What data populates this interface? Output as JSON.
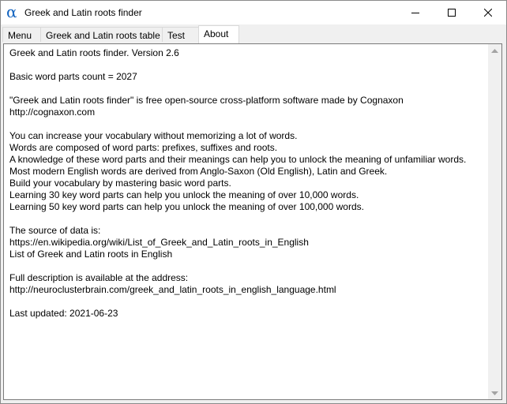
{
  "window": {
    "title": "Greek and Latin roots finder",
    "app_icon_glyph": "α",
    "accent_color": "#1565c0"
  },
  "tabs": [
    {
      "label": "Menu",
      "active": false
    },
    {
      "label": "Greek and Latin roots table",
      "active": false
    },
    {
      "label": "Test",
      "active": false
    },
    {
      "label": "About",
      "active": true
    }
  ],
  "about": {
    "version_line": "Greek and Latin roots finder. Version 2.6",
    "count_line": "Basic word parts count = 2027",
    "license_line": "\"Greek and Latin roots finder\" is free open-source cross-platform software made by Cognaxon",
    "site_url": "http://cognaxon.com",
    "intro_lines": [
      "You can increase your vocabulary without memorizing a lot of words.",
      "Words are composed of word parts: prefixes, suffixes and roots.",
      "A knowledge of these word parts and their meanings can help you to unlock the meaning of unfamiliar words.",
      "Most modern English words are derived from Anglo-Saxon (Old English), Latin and Greek.",
      "Build your vocabulary by mastering basic word parts.",
      "Learning 30 key word parts can help you unlock the meaning of over 10,000 words.",
      "Learning 50 key word parts can help you unlock the meaning of over 100,000 words."
    ],
    "source_heading": "The source of data is:",
    "source_url": "https://en.wikipedia.org/wiki/List_of_Greek_and_Latin_roots_in_English",
    "source_title": "List of Greek and Latin roots in English",
    "description_heading": "Full description is available at the address:",
    "description_url": "http://neuroclusterbrain.com/greek_and_latin_roots_in_english_language.html",
    "last_updated": "Last updated: 2021-06-23"
  }
}
